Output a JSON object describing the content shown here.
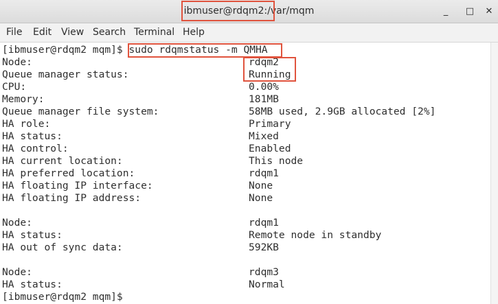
{
  "window": {
    "title": "ibmuser@rdqm2:/var/mqm",
    "minimize_glyph": "_",
    "maximize_glyph": "□",
    "close_glyph": "✕"
  },
  "menu": {
    "file": "File",
    "edit": "Edit",
    "view": "View",
    "search": "Search",
    "terminal": "Terminal",
    "help": "Help"
  },
  "terminal": {
    "prompt": "[ibmuser@rdqm2 mqm]$ ",
    "command": "sudo rdqmstatus -m QMHA",
    "rows": [
      {
        "label": "Node:",
        "value": "rdqm2"
      },
      {
        "label": "Queue manager status:",
        "value": "Running"
      },
      {
        "label": "CPU:",
        "value": "0.00%"
      },
      {
        "label": "Memory:",
        "value": "181MB"
      },
      {
        "label": "Queue manager file system:",
        "value": "58MB used, 2.9GB allocated [2%]"
      },
      {
        "label": "HA role:",
        "value": "Primary"
      },
      {
        "label": "HA status:",
        "value": "Mixed"
      },
      {
        "label": "HA control:",
        "value": "Enabled"
      },
      {
        "label": "HA current location:",
        "value": "This node"
      },
      {
        "label": "HA preferred location:",
        "value": "rdqm1"
      },
      {
        "label": "HA floating IP interface:",
        "value": "None"
      },
      {
        "label": "HA floating IP address:",
        "value": "None"
      },
      {
        "label": "",
        "value": ""
      },
      {
        "label": "Node:",
        "value": "rdqm1"
      },
      {
        "label": "HA status:",
        "value": "Remote node in standby"
      },
      {
        "label": "HA out of sync data:",
        "value": "592KB"
      },
      {
        "label": "",
        "value": ""
      },
      {
        "label": "Node:",
        "value": "rdqm3"
      },
      {
        "label": "HA status:",
        "value": "Normal"
      }
    ],
    "final_prompt": "[ibmuser@rdqm2 mqm]$ "
  },
  "colors": {
    "highlight": "#e0533d",
    "text": "#2e2e2e",
    "background": "#ffffff"
  }
}
